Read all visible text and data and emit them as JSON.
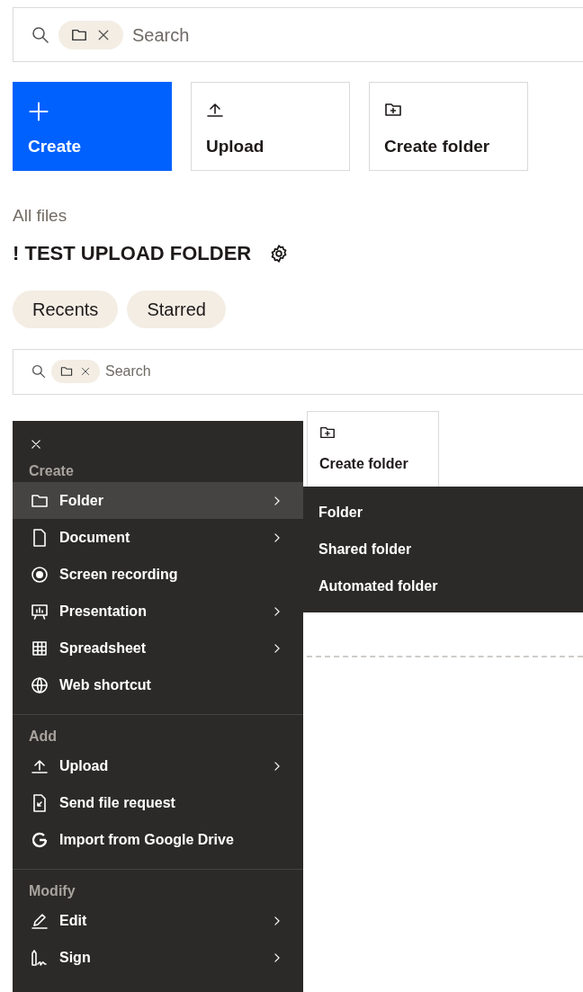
{
  "search": {
    "placeholder": "Search"
  },
  "actions": [
    {
      "label": "Create",
      "kind": "create"
    },
    {
      "label": "Upload",
      "kind": "upload"
    },
    {
      "label": "Create folder",
      "kind": "new-folder"
    }
  ],
  "breadcrumb": "All files",
  "title": "! TEST UPLOAD FOLDER",
  "filters": [
    {
      "label": "Recents"
    },
    {
      "label": "Starred"
    }
  ],
  "search_2": {
    "placeholder": "Search"
  },
  "tiles": [
    {
      "label": "Create folder",
      "kind": "new-folder"
    }
  ],
  "menu": {
    "sections": [
      {
        "title": "Create",
        "items": [
          {
            "label": "Folder",
            "kind": "folder",
            "submenu": true,
            "selected": true
          },
          {
            "label": "Document",
            "kind": "document",
            "submenu": true,
            "selected": false
          },
          {
            "label": "Screen recording",
            "kind": "record",
            "submenu": false,
            "selected": false
          },
          {
            "label": "Presentation",
            "kind": "presentation",
            "submenu": true,
            "selected": false
          },
          {
            "label": "Spreadsheet",
            "kind": "spreadsheet",
            "submenu": true,
            "selected": false
          },
          {
            "label": "Web shortcut",
            "kind": "globe",
            "submenu": false,
            "selected": false
          }
        ]
      },
      {
        "title": "Add",
        "items": [
          {
            "label": "Upload",
            "kind": "upload",
            "submenu": true,
            "selected": false
          },
          {
            "label": "Send file request",
            "kind": "file-request",
            "submenu": false,
            "selected": false
          },
          {
            "label": "Import from Google Drive",
            "kind": "google",
            "submenu": false,
            "selected": false
          }
        ]
      },
      {
        "title": "Modify",
        "items": [
          {
            "label": "Edit",
            "kind": "edit",
            "submenu": true,
            "selected": false
          },
          {
            "label": "Sign",
            "kind": "sign",
            "submenu": true,
            "selected": false
          }
        ]
      }
    ]
  },
  "submenu": {
    "items": [
      {
        "label": "Folder"
      },
      {
        "label": "Shared folder"
      },
      {
        "label": "Automated folder"
      }
    ]
  }
}
